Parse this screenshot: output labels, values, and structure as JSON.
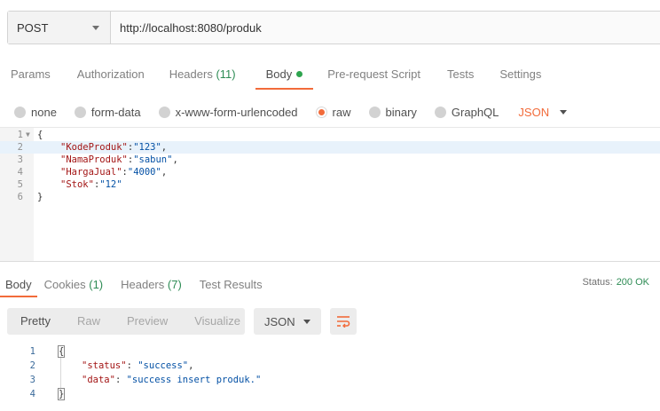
{
  "request": {
    "method": "POST",
    "url": "http://localhost:8080/produk"
  },
  "request_tabs": [
    {
      "label": "Params"
    },
    {
      "label": "Authorization"
    },
    {
      "label": "Headers",
      "count": "(11)"
    },
    {
      "label": "Body",
      "active": true
    },
    {
      "label": "Pre-request Script"
    },
    {
      "label": "Tests"
    },
    {
      "label": "Settings"
    }
  ],
  "body_types": [
    {
      "label": "none"
    },
    {
      "label": "form-data"
    },
    {
      "label": "x-www-form-urlencoded"
    },
    {
      "label": "raw",
      "selected": true
    },
    {
      "label": "binary"
    },
    {
      "label": "GraphQL"
    }
  ],
  "body_language": "JSON",
  "request_body_lines": [
    {
      "n": "1",
      "text": "{"
    },
    {
      "n": "2",
      "key": "\"KodeProduk\"",
      "value": "\"123\"",
      "trail": ","
    },
    {
      "n": "3",
      "key": "\"NamaProduk\"",
      "value": "\"sabun\"",
      "trail": ","
    },
    {
      "n": "4",
      "key": "\"HargaJual\"",
      "value": "\"4000\"",
      "trail": ","
    },
    {
      "n": "5",
      "key": "\"Stok\"",
      "value": "\"12\"",
      "trail": ""
    },
    {
      "n": "6",
      "text": "}"
    }
  ],
  "response_tabs": [
    {
      "label": "Body",
      "active": true
    },
    {
      "label": "Cookies",
      "count": "(1)"
    },
    {
      "label": "Headers",
      "count": "(7)"
    },
    {
      "label": "Test Results"
    }
  ],
  "status": {
    "label": "Status:",
    "value": "200 OK"
  },
  "view_modes": [
    "Pretty",
    "Raw",
    "Preview",
    "Visualize"
  ],
  "response_format": "JSON",
  "response_lines": [
    {
      "n": "1",
      "text": "{"
    },
    {
      "n": "2",
      "key": "\"status\"",
      "value": "\"success\"",
      "trail": ","
    },
    {
      "n": "3",
      "key": "\"data\"",
      "value": "\"success insert produk.\"",
      "trail": ""
    },
    {
      "n": "4",
      "text": "}"
    }
  ],
  "colors": {
    "accent": "#f26b3a",
    "count_green": "#2e8c55",
    "dot_green": "#2ea44f"
  },
  "icons": {
    "method_dropdown": "chevron-down-icon",
    "wrap": "wrap-lines-icon"
  }
}
